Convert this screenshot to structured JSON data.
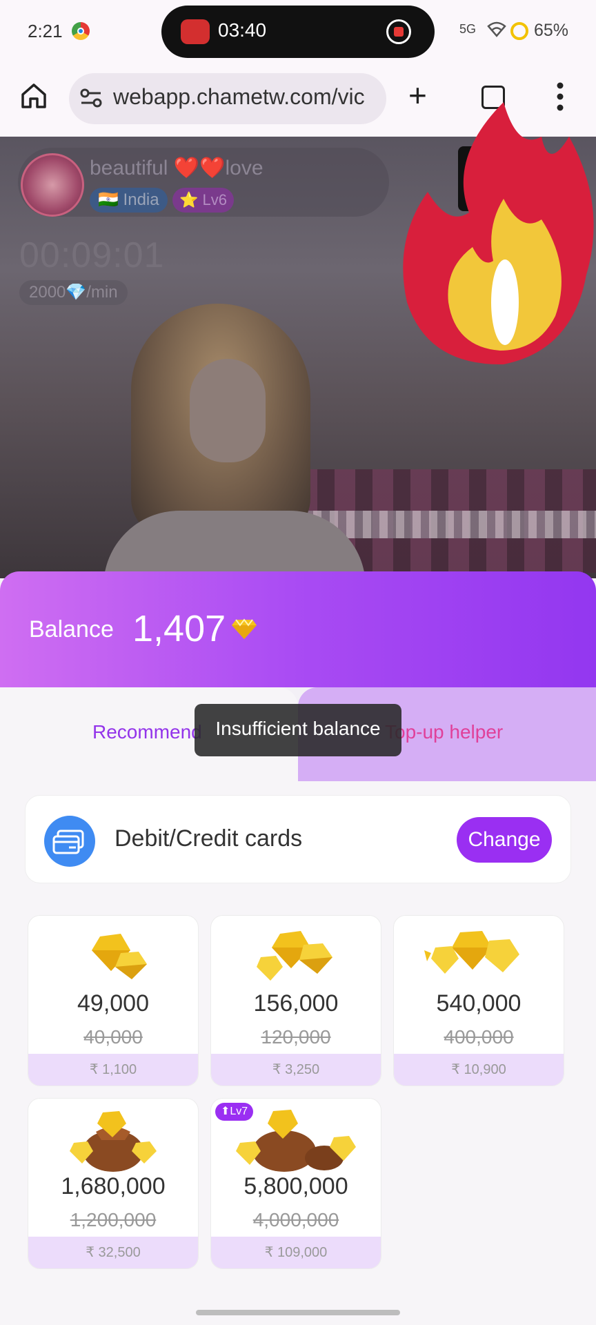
{
  "status_bar": {
    "time": "2:21",
    "recording_time": "03:40",
    "signal": "5G",
    "battery": "65%"
  },
  "browser": {
    "url": "webapp.chametw.com/vic"
  },
  "call": {
    "host_name": "beautiful ❤️❤️love",
    "country": "🇮🇳 India",
    "level": "⭐ Lv6",
    "timer": "00:09:01",
    "rate": "2000💎/min"
  },
  "wallet": {
    "balance_label": "Balance",
    "balance_value": "1,407",
    "tabs": [
      "Recommend",
      "Top-up helper"
    ],
    "toast": "Insufficient balance",
    "payment_method": "Debit/Credit cards",
    "change_label": "Change"
  },
  "packages": [
    {
      "amount": "49,000",
      "original": "40,000",
      "price": "₹ 1,100"
    },
    {
      "amount": "156,000",
      "original": "120,000",
      "price": "₹ 3,250"
    },
    {
      "amount": "540,000",
      "original": "400,000",
      "price": "₹ 10,900"
    },
    {
      "amount": "1,680,000",
      "original": "1,200,000",
      "price": "₹ 32,500"
    },
    {
      "amount": "5,800,000",
      "original": "4,000,000",
      "price": "₹ 109,000",
      "badge": "⬆Lv7"
    }
  ],
  "colors": {
    "accent": "#9a2ff2",
    "header_gradient_start": "#cf6ef2",
    "header_gradient_end": "#9337f0",
    "helper_tab": "#e0409a"
  }
}
